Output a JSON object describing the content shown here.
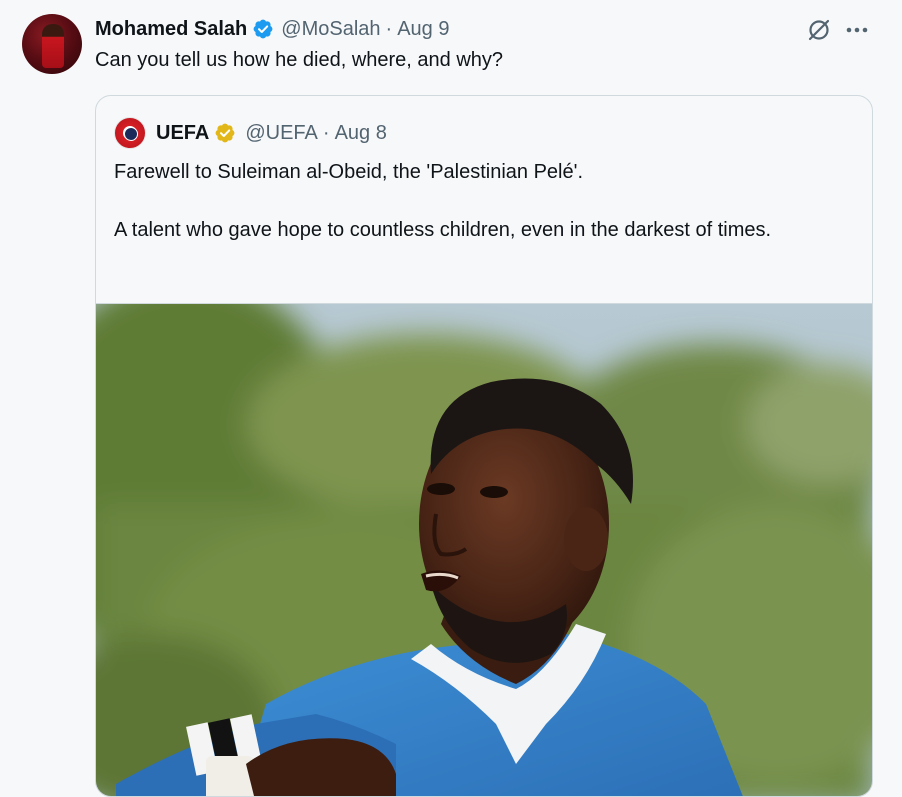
{
  "tweet": {
    "author_name": "Mohamed Salah",
    "handle": "@MoSalah",
    "separator": "·",
    "date": "Aug 9",
    "text": "Can you tell us how he died, where, and why?"
  },
  "quoted": {
    "author_name": "UEFA",
    "handle": "@UEFA",
    "separator": "·",
    "date": "Aug 8",
    "paragraphs": [
      "Farewell to Suleiman al-Obeid, the 'Palestinian Pelé'.",
      "A talent who gave hope to countless children, even in the darkest of times."
    ]
  },
  "icons": {
    "verified_blue": "verified-badge-icon",
    "verified_gold": "verified-gold-badge-icon",
    "grok": "grok-icon",
    "more": "more-options-icon"
  },
  "colors": {
    "text_primary": "#0f1419",
    "text_secondary": "#536471",
    "verified_blue": "#1d9bf0",
    "verified_gold": "#e2b719",
    "border": "#cfd9de",
    "background": "#f7f8f9"
  }
}
